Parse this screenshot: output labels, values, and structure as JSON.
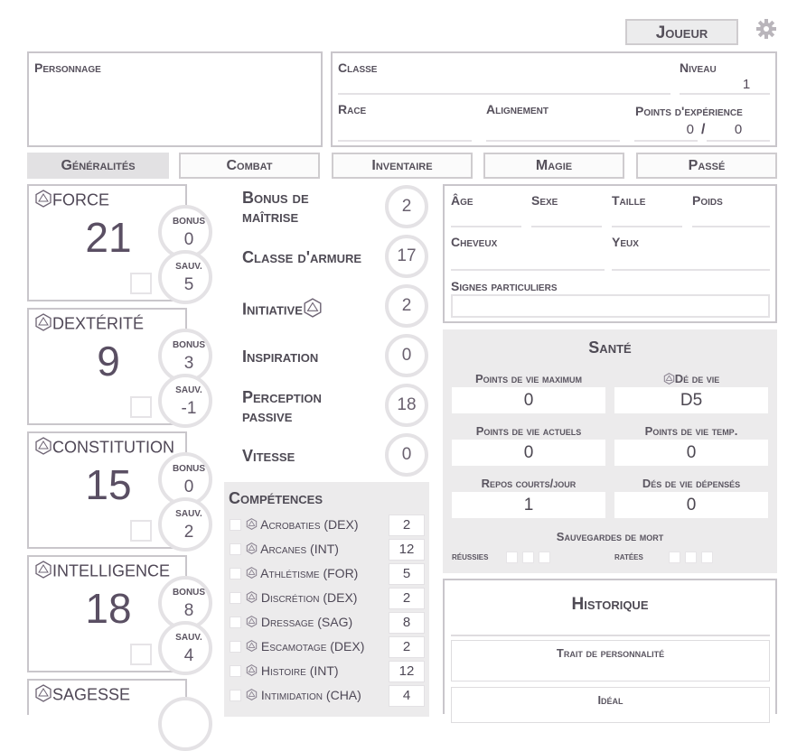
{
  "header": {
    "player_button": "Joueur",
    "settings_icon": "gear-icon"
  },
  "identity": {
    "personnage_label": "Personnage",
    "classe_label": "Classe",
    "niveau_label": "Niveau",
    "niveau_value": "1",
    "race_label": "Race",
    "alignement_label": "Alignement",
    "xp_label": "Points d'expérience",
    "xp_current": "0",
    "xp_sep": "/",
    "xp_next": "0"
  },
  "tabs": [
    "Généralités",
    "Combat",
    "Inventaire",
    "Magie",
    "Passé"
  ],
  "abilities": [
    {
      "name": "FORCE",
      "score": "21",
      "bonus_label": "BONUS",
      "bonus": "0",
      "save_label": "SAUV.",
      "save": "5"
    },
    {
      "name": "DEXTÉRITÉ",
      "score": "9",
      "bonus_label": "BONUS",
      "bonus": "3",
      "save_label": "SAUV.",
      "save": "-1"
    },
    {
      "name": "CONSTITUTION",
      "score": "15",
      "bonus_label": "BONUS",
      "bonus": "0",
      "save_label": "SAUV.",
      "save": "2"
    },
    {
      "name": "INTELLIGENCE",
      "score": "18",
      "bonus_label": "BONUS",
      "bonus": "8",
      "save_label": "SAUV.",
      "save": "4"
    },
    {
      "name": "SAGESSE"
    }
  ],
  "stats": [
    {
      "label": "Bonus de maîtrise",
      "value": "2"
    },
    {
      "label": "Classe d'armure",
      "value": "17"
    },
    {
      "label": "Initiative",
      "value": "2"
    },
    {
      "label": "Inspiration",
      "value": "0"
    },
    {
      "label": "Perception passive",
      "value": "18"
    },
    {
      "label": "Vitesse",
      "value": "0"
    }
  ],
  "competences": {
    "title": "Compétences",
    "items": [
      {
        "name": "Acrobaties (DEX)",
        "value": "2"
      },
      {
        "name": "Arcanes (INT)",
        "value": "12"
      },
      {
        "name": "Athlétisme (FOR)",
        "value": "5"
      },
      {
        "name": "Discrétion (DEX)",
        "value": "2"
      },
      {
        "name": "Dressage (SAG)",
        "value": "8"
      },
      {
        "name": "Escamotage (DEX)",
        "value": "2"
      },
      {
        "name": "Histoire (INT)",
        "value": "12"
      },
      {
        "name": "Intimidation (CHA)",
        "value": "4"
      }
    ]
  },
  "description": {
    "age": "Âge",
    "sexe": "Sexe",
    "taille": "Taille",
    "poids": "Poids",
    "cheveux": "Cheveux",
    "yeux": "Yeux",
    "signes": "Signes particuliers"
  },
  "sante": {
    "title": "Santé",
    "pv_max_label": "Points de vie maximum",
    "pv_max": "0",
    "de_vie_label": "Dé de vie",
    "de_vie": "D5",
    "pv_actuels_label": "Points de vie actuels",
    "pv_actuels": "0",
    "pv_temp_label": "Points de vie temp.",
    "pv_temp": "0",
    "repos_label": "Repos courts/jour",
    "repos": "1",
    "des_depenses_label": "Dés de vie dépensés",
    "des_depenses": "0",
    "mort_label": "Sauvegardes de mort",
    "reussies": "réussies",
    "ratees": "ratées"
  },
  "historique": {
    "title": "Historique",
    "trait_label": "Trait de personnalité",
    "ideal_label": "Idéal"
  }
}
